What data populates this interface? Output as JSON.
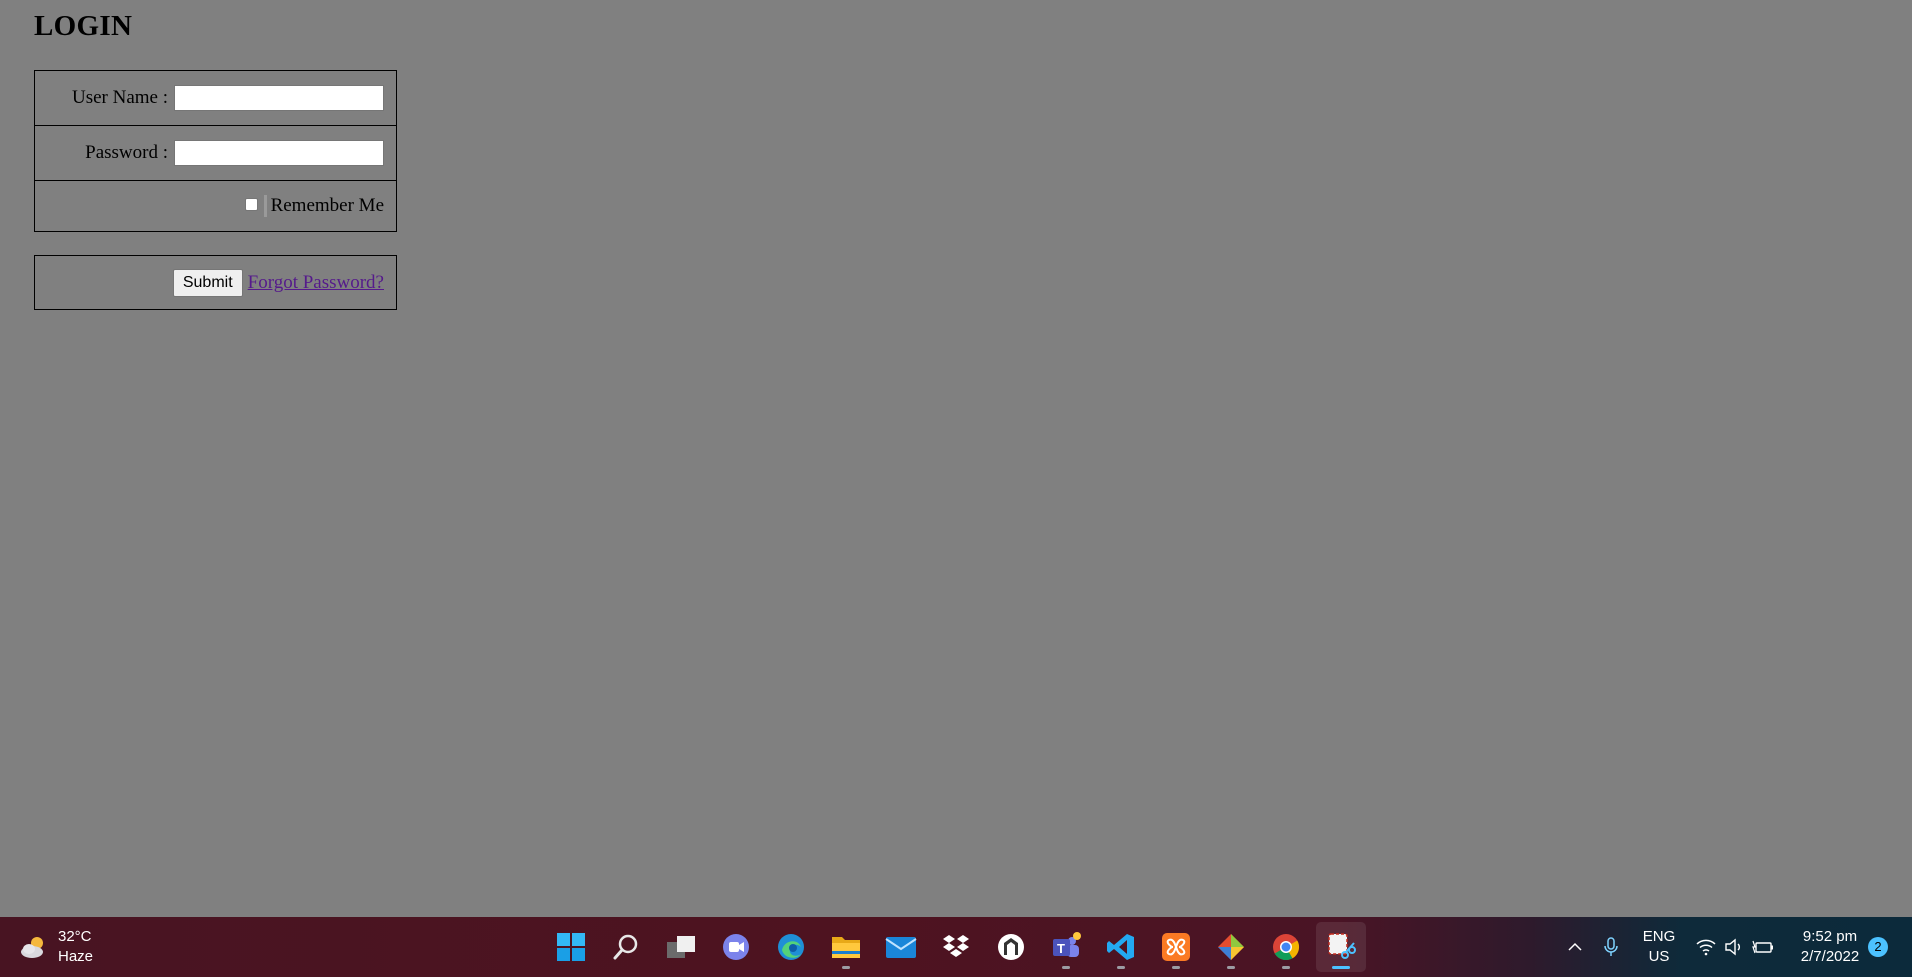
{
  "login": {
    "title": "LOGIN",
    "username_label": "User Name :",
    "username_value": "",
    "password_label": "Password :",
    "password_value": "",
    "remember_label": "Remember Me",
    "remember_checked": false,
    "submit_label": "Submit",
    "forgot_link": "Forgot Password?"
  },
  "taskbar": {
    "weather": {
      "temperature": "32°C",
      "condition": "Haze",
      "icon": "partly-cloudy-icon"
    },
    "apps": [
      {
        "name": "start",
        "icon": "windows-start-icon",
        "running": false
      },
      {
        "name": "search",
        "icon": "search-icon",
        "running": false
      },
      {
        "name": "task-view",
        "icon": "task-view-icon",
        "running": false
      },
      {
        "name": "chat",
        "icon": "teams-chat-icon",
        "running": false
      },
      {
        "name": "edge",
        "icon": "edge-icon",
        "running": false
      },
      {
        "name": "file-explorer",
        "icon": "folder-icon",
        "running": true
      },
      {
        "name": "mail",
        "icon": "mail-icon",
        "running": false
      },
      {
        "name": "dropbox",
        "icon": "dropbox-icon",
        "running": false
      },
      {
        "name": "app-shield",
        "icon": "shield-app-icon",
        "running": false
      },
      {
        "name": "teams",
        "icon": "teams-icon",
        "running": true
      },
      {
        "name": "vscode",
        "icon": "vscode-icon",
        "running": true
      },
      {
        "name": "xampp",
        "icon": "xampp-icon",
        "running": true
      },
      {
        "name": "git",
        "icon": "git-icon",
        "running": true
      },
      {
        "name": "chrome",
        "icon": "chrome-icon",
        "running": true
      },
      {
        "name": "snipping-tool",
        "icon": "snipping-tool-icon",
        "running": true,
        "active": true
      }
    ],
    "tray": {
      "language_top": "ENG",
      "language_bottom": "US",
      "time": "9:52 pm",
      "date": "2/7/2022",
      "notifications": "2"
    }
  },
  "colors": {
    "page_background": "#808080",
    "link": "#551a8b",
    "accent": "#4cc2ff"
  }
}
